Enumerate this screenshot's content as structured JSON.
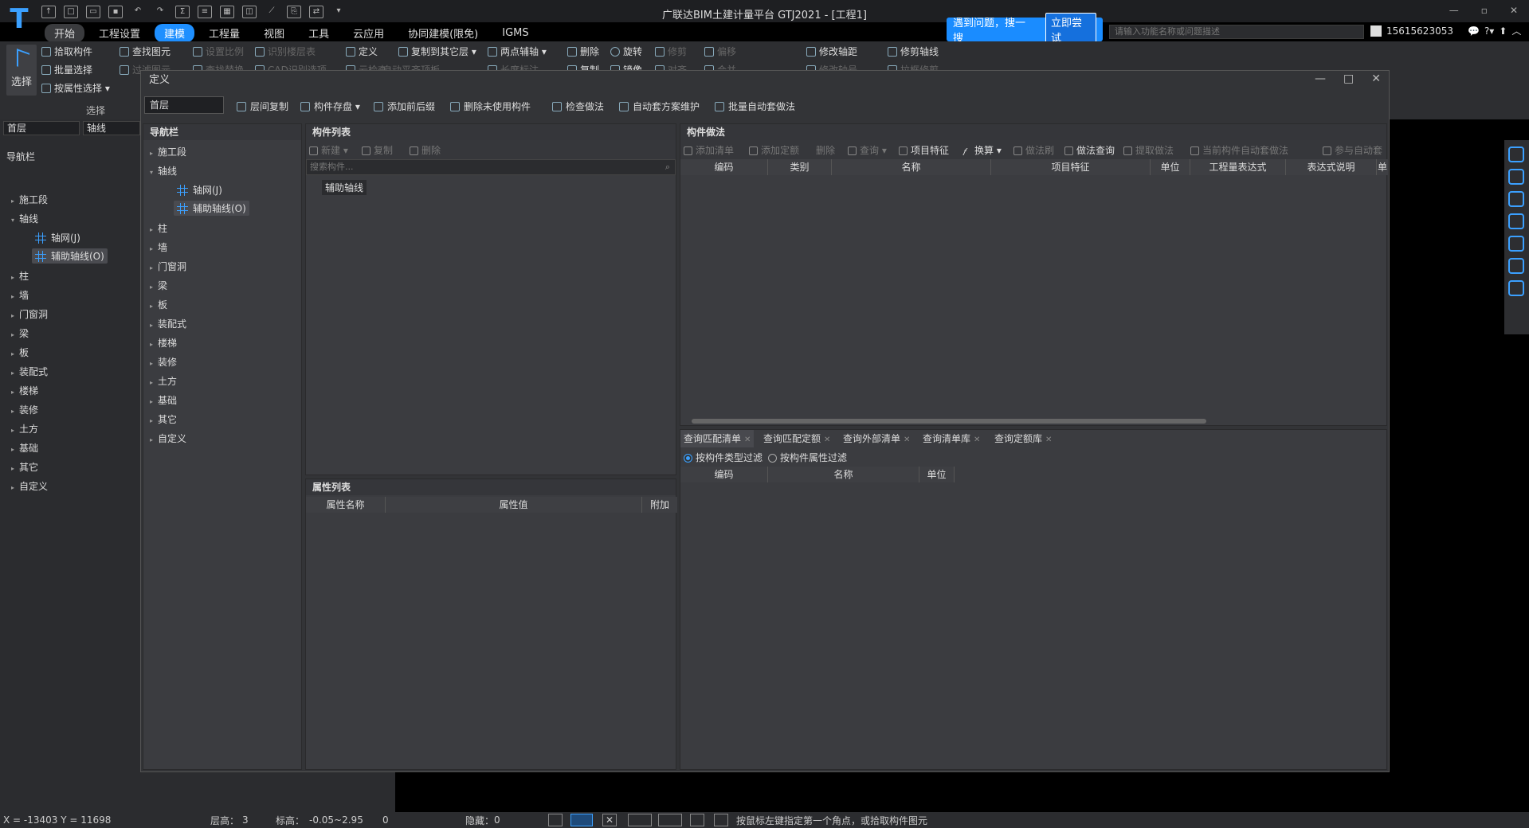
{
  "app": {
    "logo": "T",
    "title": "广联达BIM土建计量平台 GTJ2021 - [工程1]",
    "window_controls": [
      "—",
      "▫",
      "✕"
    ]
  },
  "menu": [
    "开始",
    "工程设置",
    "建模",
    "工程量",
    "视图",
    "工具",
    "云应用",
    "协同建模(限免)",
    "IGMS"
  ],
  "menu_active": "建模",
  "help": {
    "text": "遇到问题，搜一搜",
    "button": "立即尝试"
  },
  "top_search": {
    "placeholder": "请输入功能名称或问题描述"
  },
  "user": {
    "phone": "15615623053",
    "icons": [
      "💬",
      "?▾",
      "⬆",
      "︿"
    ]
  },
  "ribbon": {
    "select_label": "选择",
    "group_label": "选择",
    "col1": [
      "拾取构件",
      "批量选择",
      "按属性选择"
    ],
    "col2": [
      "查找图元",
      "过滤图元"
    ],
    "col3": [
      "设置比例",
      "查找替换"
    ],
    "col4": [
      "识别楼层表",
      "CAD识别选项"
    ],
    "col5": [
      "定义",
      "云检查"
    ],
    "col5b": "自动平齐顶板",
    "col6": [
      "复制到其它层",
      "两点辅轴",
      "长度标注"
    ],
    "col7": [
      "删除",
      "复制"
    ],
    "col7b": [
      "旋转",
      "镜像"
    ],
    "col7c": [
      "修剪",
      "对齐"
    ],
    "col7d": [
      "偏移",
      "合并"
    ],
    "col8": [
      "修改轴距",
      "修改轴号"
    ],
    "col9": [
      "修剪轴线",
      "拉框修剪"
    ]
  },
  "left": {
    "floor": "首层",
    "axis": "轴线",
    "nav_title": "导航栏",
    "items": [
      "施工段",
      "轴线",
      "柱",
      "墙",
      "门窗洞",
      "梁",
      "板",
      "装配式",
      "楼梯",
      "装修",
      "土方",
      "基础",
      "其它",
      "自定义"
    ],
    "sub": [
      "轴网(J)",
      "辅助轴线(O)"
    ]
  },
  "dialog": {
    "title": "定义",
    "floor": "首层",
    "tools": [
      "层间复制",
      "构件存盘",
      "添加前后缀",
      "删除未使用构件",
      "检查做法",
      "自动套方案维护",
      "批量自动套做法"
    ],
    "nav_title": "导航栏",
    "nav_items": [
      "施工段",
      "轴线",
      "柱",
      "墙",
      "门窗洞",
      "梁",
      "板",
      "装配式",
      "楼梯",
      "装修",
      "土方",
      "基础",
      "其它",
      "自定义"
    ],
    "nav_sub": [
      "轴网(J)",
      "辅助轴线(O)"
    ],
    "complist": {
      "title": "构件列表",
      "tools": [
        "新建",
        "复制",
        "删除"
      ],
      "search": "搜索构件...",
      "item": "辅助轴线"
    },
    "props": {
      "title": "属性列表",
      "cols": [
        "属性名称",
        "属性值",
        "附加"
      ]
    },
    "method": {
      "title": "构件做法",
      "tools": [
        "添加清单",
        "添加定额",
        "删除",
        "查询",
        "项目特征",
        "换算",
        "做法刷",
        "做法查询",
        "提取做法",
        "当前构件自动套做法",
        "参与自动套"
      ],
      "cols": [
        "编码",
        "类别",
        "名称",
        "项目特征",
        "单位",
        "工程量表达式",
        "表达式说明",
        "单"
      ]
    },
    "query": {
      "tabs": [
        "查询匹配清单",
        "查询匹配定额",
        "查询外部清单",
        "查询清单库",
        "查询定额库"
      ],
      "radios": [
        "按构件类型过滤",
        "按构件属性过滤"
      ],
      "cols": [
        "编码",
        "名称",
        "单位"
      ]
    }
  },
  "status": {
    "coords": "X = -13403 Y = 11698",
    "floor_h_label": "层高：",
    "floor_h": "3",
    "elev_label": "标高：",
    "elev": "-0.05~2.95",
    "zero": "0",
    "hidden_label": "隐藏：",
    "hidden": "0",
    "hint": "按鼠标左键指定第一个角点，或拾取构件图元"
  }
}
